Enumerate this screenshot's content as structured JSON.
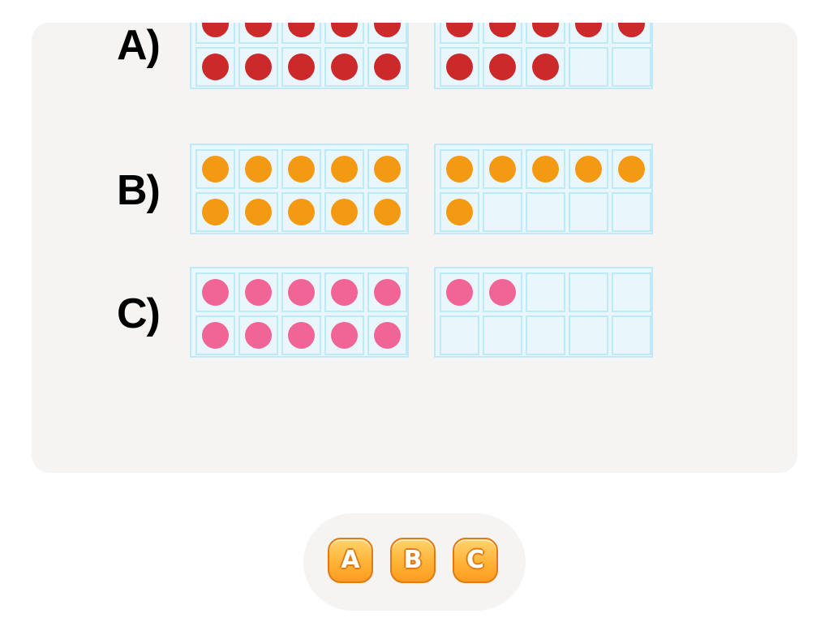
{
  "rows": [
    {
      "label": "A)",
      "left_dots": 10,
      "right_dots": 8,
      "color": "#cc2a2a"
    },
    {
      "label": "B)",
      "left_dots": 10,
      "right_dots": 6,
      "color": "#f39a12"
    },
    {
      "label": "C)",
      "left_dots": 10,
      "right_dots": 2,
      "color": "#f06595"
    }
  ],
  "colors": {
    "panel": "#f5f4f3",
    "frame_border": "#bfe9f7",
    "frame_fill": "#e9f6fb",
    "button": "#ffb338"
  },
  "answer_buttons": [
    {
      "label": "A"
    },
    {
      "label": "B"
    },
    {
      "label": "C"
    }
  ]
}
